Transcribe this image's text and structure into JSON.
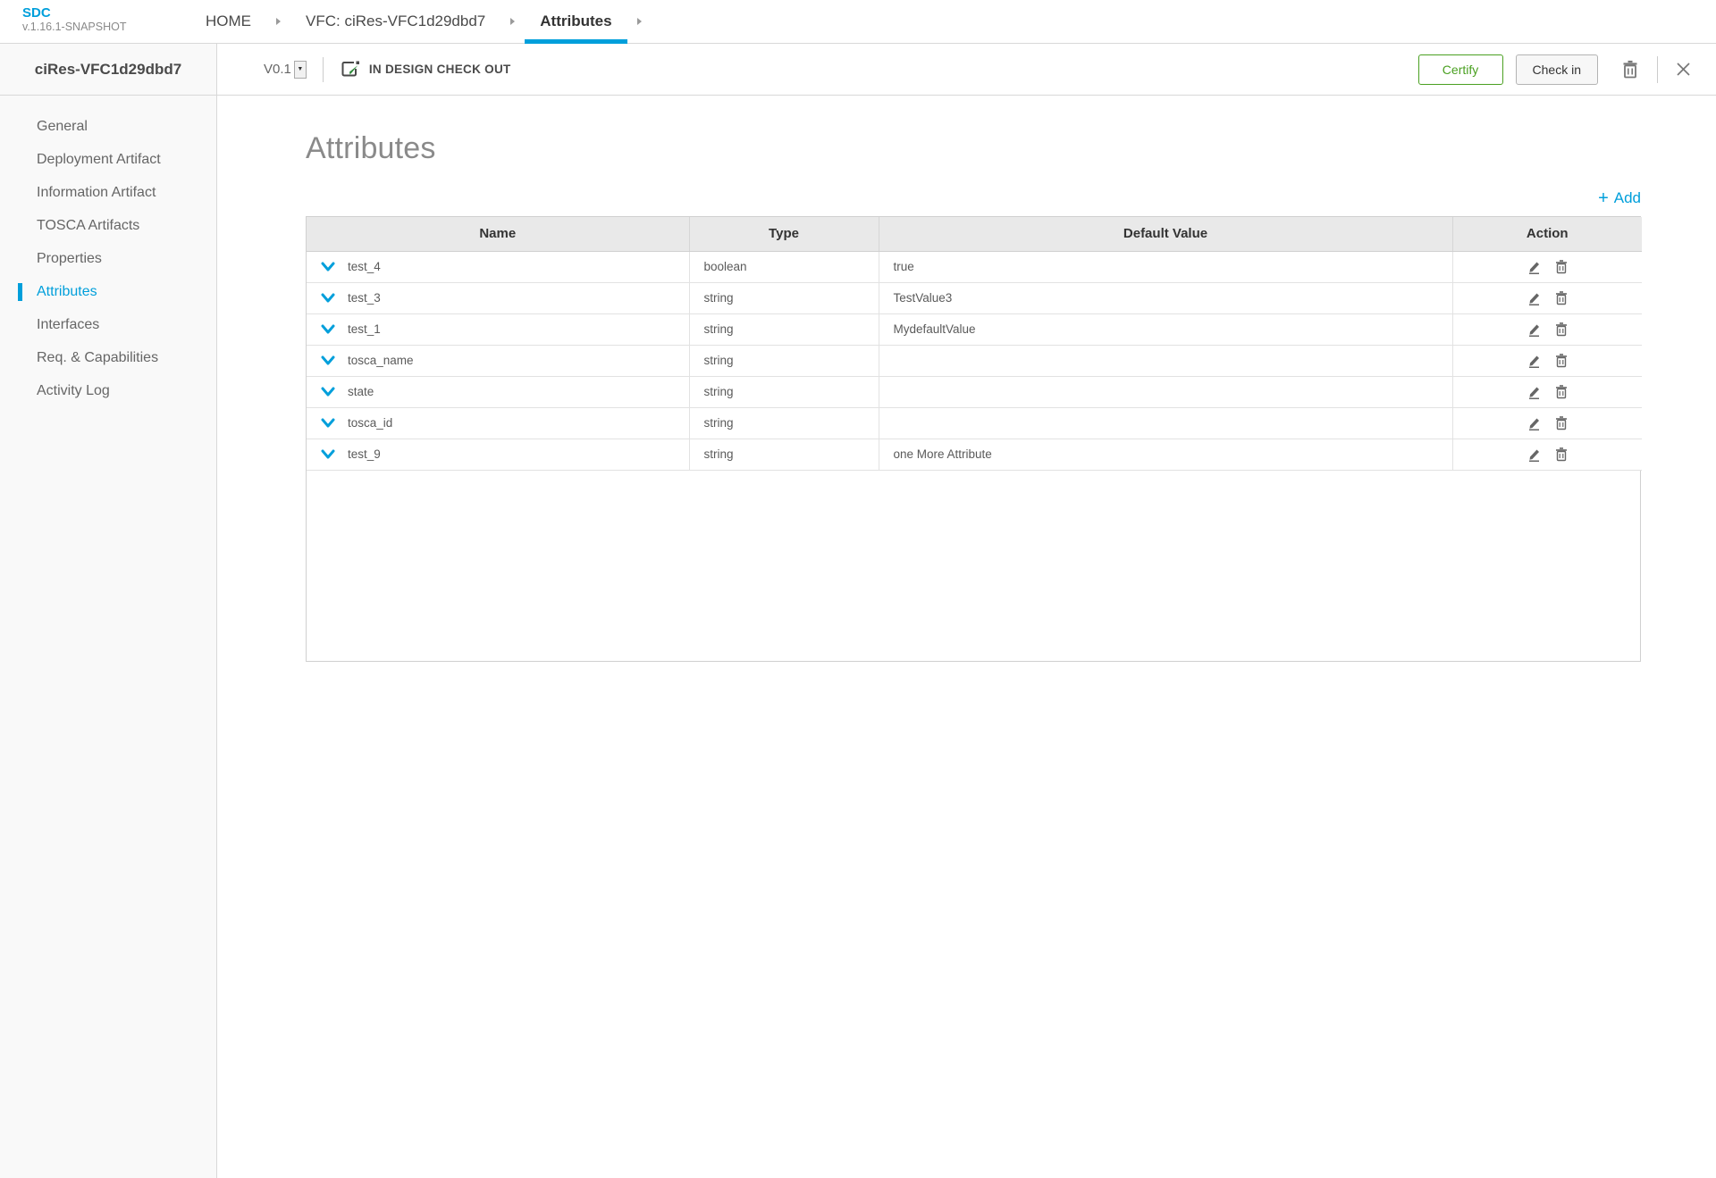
{
  "app": {
    "logo": "SDC",
    "version": "v.1.16.1-SNAPSHOT"
  },
  "breadcrumb": {
    "items": [
      {
        "label": "HOME",
        "active": false
      },
      {
        "label": "VFC: ciRes-VFC1d29dbd7",
        "active": false
      },
      {
        "label": "Attributes",
        "active": true
      }
    ]
  },
  "sidebar": {
    "title": "ciRes-VFC1d29dbd7",
    "items": [
      {
        "label": "General",
        "active": false
      },
      {
        "label": "Deployment Artifact",
        "active": false
      },
      {
        "label": "Information Artifact",
        "active": false
      },
      {
        "label": "TOSCA Artifacts",
        "active": false
      },
      {
        "label": "Properties",
        "active": false
      },
      {
        "label": "Attributes",
        "active": true
      },
      {
        "label": "Interfaces",
        "active": false
      },
      {
        "label": "Req. & Capabilities",
        "active": false
      },
      {
        "label": "Activity Log",
        "active": false
      }
    ]
  },
  "toolbar": {
    "version": "V0.1",
    "version_dropdown_icon": "▼",
    "status": "IN DESIGN CHECK OUT",
    "certify_label": "Certify",
    "checkin_label": "Check in"
  },
  "main": {
    "title": "Attributes",
    "add_plus": "+",
    "add_label": "Add"
  },
  "table": {
    "columns": [
      "Name",
      "Type",
      "Default Value",
      "Action"
    ],
    "rows": [
      {
        "name": "test_4",
        "type": "boolean",
        "default_value": "true"
      },
      {
        "name": "test_3",
        "type": "string",
        "default_value": "TestValue3"
      },
      {
        "name": "test_1",
        "type": "string",
        "default_value": "MydefaultValue"
      },
      {
        "name": "tosca_name",
        "type": "string",
        "default_value": ""
      },
      {
        "name": "state",
        "type": "string",
        "default_value": ""
      },
      {
        "name": "tosca_id",
        "type": "string",
        "default_value": ""
      },
      {
        "name": "test_9",
        "type": "string",
        "default_value": "one More Attribute"
      }
    ]
  },
  "colors": {
    "accent": "#009fdb",
    "green": "#4aa021",
    "header_bg": "#e9e9e9",
    "sidebar_bg": "#f9f9f9"
  }
}
